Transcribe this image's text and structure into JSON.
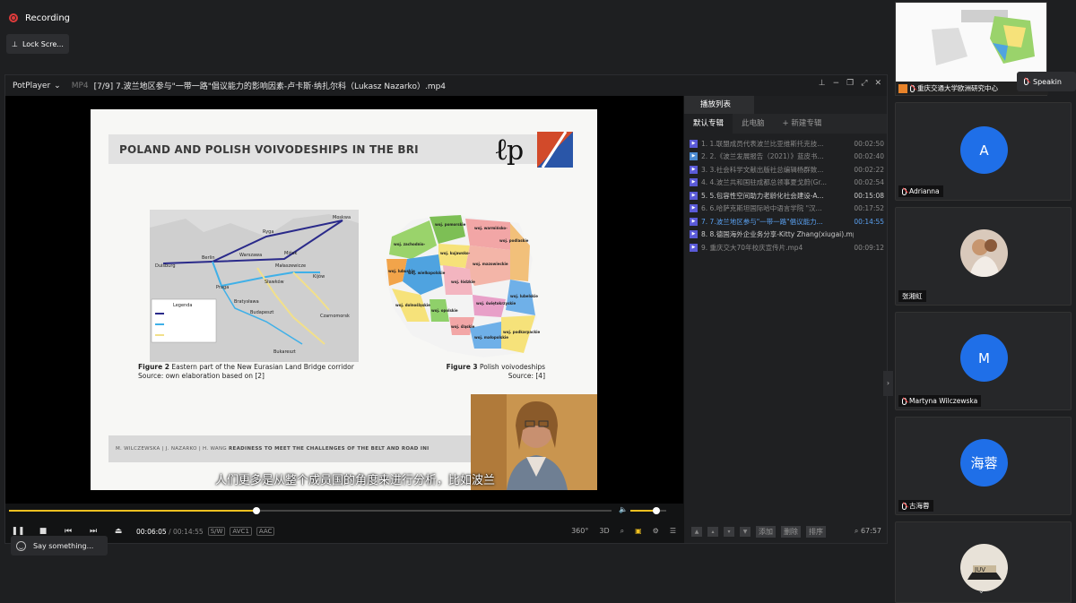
{
  "meeting": {
    "recording_label": "Recording",
    "lock_label": "Lock Scre...",
    "say_placeholder": "Say something...",
    "speaking_label": "Speakin"
  },
  "player": {
    "app_name": "PotPlayer",
    "format": "MP4",
    "title": "[7/9] 7.波兰地区参与\"一带一路\"倡议能力的影响因素-卢卡斯·纳扎尔科（Lukasz Nazarko）.mp4",
    "time_current": "00:06:05",
    "time_sep": "/",
    "time_total": "00:14:55",
    "tags": [
      "S/W",
      "AVC1",
      "AAC"
    ],
    "progress": 0.41,
    "volume": 0.72,
    "right_ctrl_labels": [
      "360°",
      "3D"
    ]
  },
  "slide": {
    "heading": "POLAND AND POLISH VOIVODESHIPS IN THE BRI",
    "fig2_label": "Figure 2",
    "fig2_caption": "Eastern part of the New Eurasian Land Bridge corridor",
    "fig2_source": "Source: own elaboration based on [2]",
    "fig3_label": "Figure 3",
    "fig3_caption": "Polish voivodeships",
    "fig3_source": "Source: [4]",
    "footer_authors": "M. WILCZEWSKA | J. NAZARKO | H. WANG",
    "footer_title": "READINESS TO MEET THE CHALLENGES OF THE BELT AND ROAD INI",
    "subtitle": "人们更多是从整个成员国的角度来进行分析，比如波兰",
    "legend_title": "Legenda",
    "map_cities": [
      "Moskwa",
      "Ryga",
      "Mińsk",
      "Warszawa",
      "Berlin",
      "Duisburg",
      "Małaszewicze",
      "Kijów",
      "Praga",
      "Sławków",
      "Bratysława",
      "Budapeszt",
      "Czarnomorsk",
      "Bukareszt"
    ],
    "voivodeships": [
      "woj. pomorskie",
      "woj. warmińsko-mazurskie",
      "woj. zachodnio-pomorskie",
      "woj. kujawsko-pomorskie",
      "woj. podlaskie",
      "woj. mazowieckie",
      "woj. wielkopolskie",
      "woj. lubuskie",
      "woj. łódzkie",
      "woj. lubelskie",
      "woj. dolnośląskie",
      "woj. opolskie",
      "woj. świętokrzyskie",
      "woj. śląskie",
      "woj. małopolskie",
      "woj. podkarpackie"
    ]
  },
  "playlist": {
    "header": "播放列表",
    "tabs": [
      "默认专辑",
      "此电脑",
      "+ 新建专辑"
    ],
    "items": [
      {
        "name": "1. 1.联盟成员代表波兰比亚维斯托克技...",
        "dur": "00:02:50",
        "kind": "video"
      },
      {
        "name": "2. 2.《波兰发展报告（2021）》蓝皮书...",
        "dur": "00:02:40",
        "kind": "doc"
      },
      {
        "name": "3. 3.社会科学文献出版社总编辑杨群致...",
        "dur": "00:02:22",
        "kind": "video"
      },
      {
        "name": "4. 4.波兰共和国驻成都总领事夏戈蔚(Gr...",
        "dur": "00:02:54",
        "kind": "video"
      },
      {
        "name": "5. 5.包容性空间助力老龄化社会建设-A...",
        "dur": "00:15:08",
        "kind": "video"
      },
      {
        "name": "6. 6.哈萨克斯坦国际哈中语言学院 \"汉...",
        "dur": "00:17:52",
        "kind": "video"
      },
      {
        "name": "7. 7.波兰地区参与\"一带一路\"倡议能力...",
        "dur": "00:14:55",
        "kind": "video"
      },
      {
        "name": "8. 8.德国海外企业务分享-Kitty Zhang(xiugai).mp4",
        "dur": "",
        "kind": "video"
      },
      {
        "name": "9. 重庆交大70年校庆宣传片.mp4",
        "dur": "00:09:12",
        "kind": "video"
      }
    ],
    "buttons": [
      "添加",
      "删除",
      "排序"
    ],
    "count": "67:57"
  },
  "participants": {
    "share_name": "重庆交通大学欧洲研究中心",
    "people": [
      {
        "initial": "A",
        "name": "Adrianna"
      },
      {
        "initial": "",
        "name": "张湘虹"
      },
      {
        "initial": "M",
        "name": "Martyna Wilczewska"
      },
      {
        "initial": "海蓉",
        "name": "古海蓉"
      },
      {
        "initial": "",
        "name": ""
      }
    ]
  },
  "colors": {
    "avatar_blue": "#1f6fe8",
    "accent_yellow": "#f0c020",
    "playlist_current": "#5aa0f0",
    "recording_red": "#e03b3b"
  }
}
